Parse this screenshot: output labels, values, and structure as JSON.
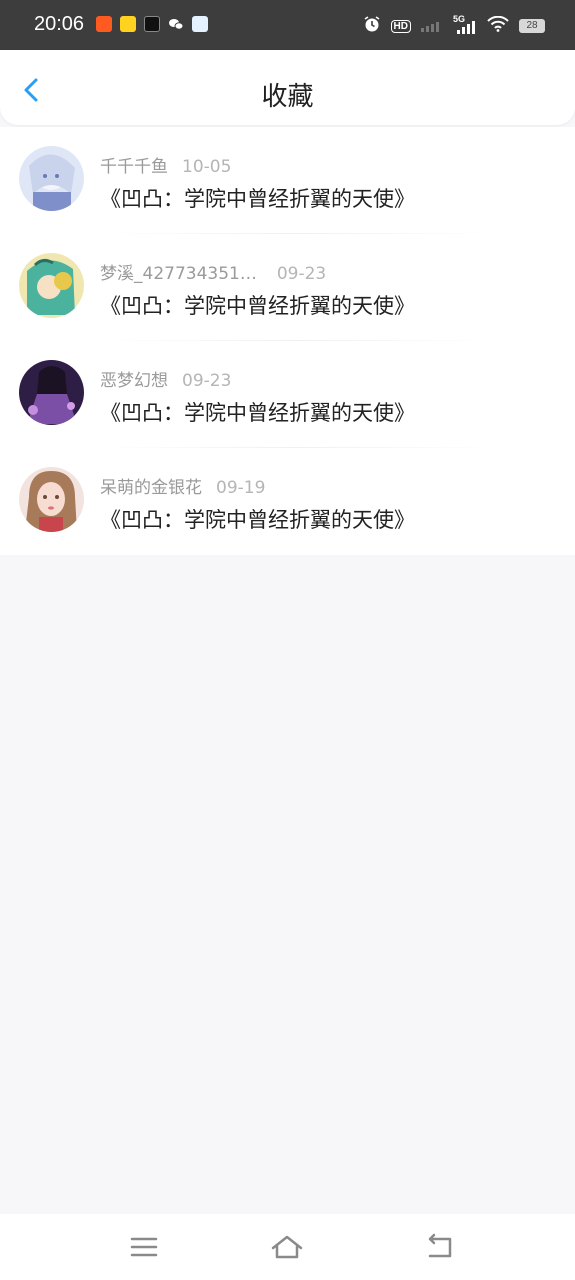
{
  "status_bar": {
    "time": "20:06",
    "hd_label": "HD",
    "network": "5G",
    "battery": "28",
    "app_icons": [
      "taobao-app-icon",
      "qq-app-icon",
      "tiktok-app-icon",
      "wechat-app-icon",
      "cloud-app-icon"
    ]
  },
  "header": {
    "title": "收藏",
    "back_icon": "chevron-left-icon",
    "accent_color": "#2a9df4"
  },
  "favorites": [
    {
      "username": "千千千鱼",
      "date": "10-05",
      "book": "《凹凸：学院中曾经折翼的天使》"
    },
    {
      "username": "梦溪_427734351…",
      "date": "09-23",
      "book": "《凹凸：学院中曾经折翼的天使》"
    },
    {
      "username": "恶梦幻想",
      "date": "09-23",
      "book": "《凹凸：学院中曾经折翼的天使》"
    },
    {
      "username": "呆萌的金银花",
      "date": "09-19",
      "book": "《凹凸：学院中曾经折翼的天使》"
    }
  ],
  "nav_bar": {
    "icons": [
      "menu-icon",
      "home-icon",
      "back-icon"
    ]
  }
}
